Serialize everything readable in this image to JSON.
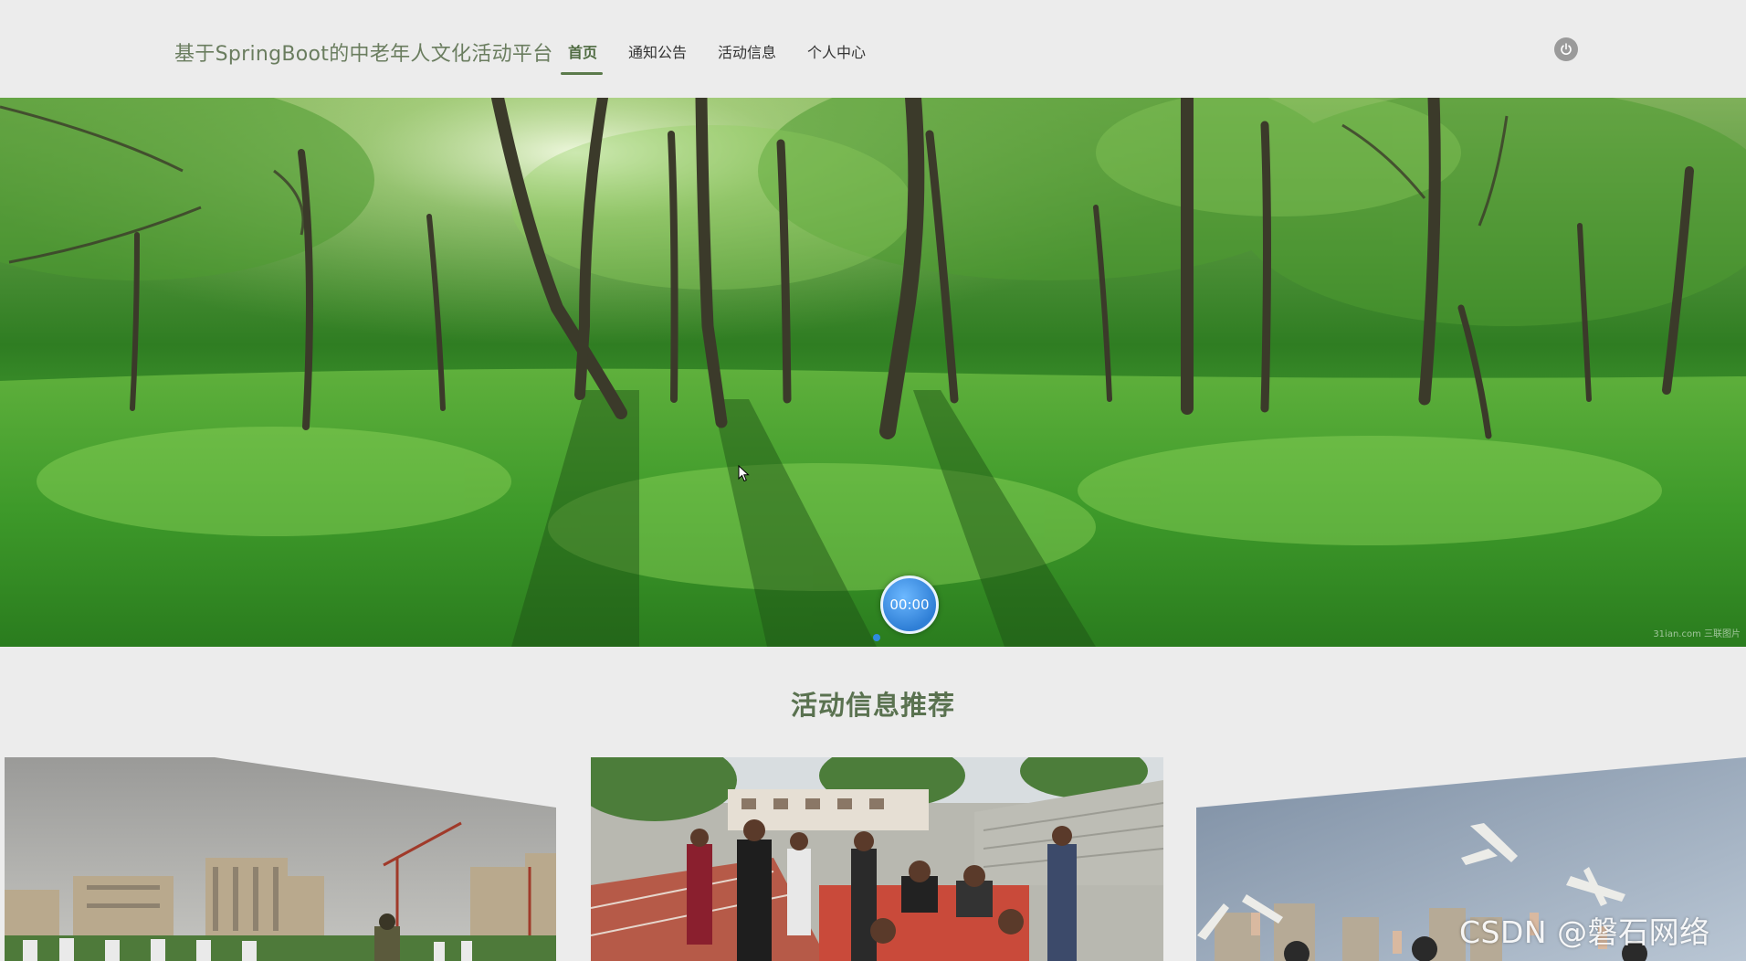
{
  "header": {
    "brand": "基于SpringBoot的中老年人文化活动平台",
    "nav": [
      {
        "label": "首页",
        "active": true
      },
      {
        "label": "通知公告",
        "active": false
      },
      {
        "label": "活动信息",
        "active": false
      },
      {
        "label": "个人中心",
        "active": false
      }
    ],
    "power_icon": "power-icon"
  },
  "banner": {
    "timer": "00:00",
    "watermark": "31ian.com 三联图片",
    "indicator_count": 1,
    "active_indicator": 1
  },
  "section": {
    "title": "活动信息推荐"
  },
  "cards": [
    {
      "image": "school-exercise-photo"
    },
    {
      "image": "students-table-photo"
    },
    {
      "image": "paper-planes-photo"
    }
  ],
  "overlay_watermark": "CSDN @磐石网络",
  "colors": {
    "accent": "#5b7a4b",
    "brand_text": "#6a7d5f",
    "indicator": "#2f8be0"
  }
}
